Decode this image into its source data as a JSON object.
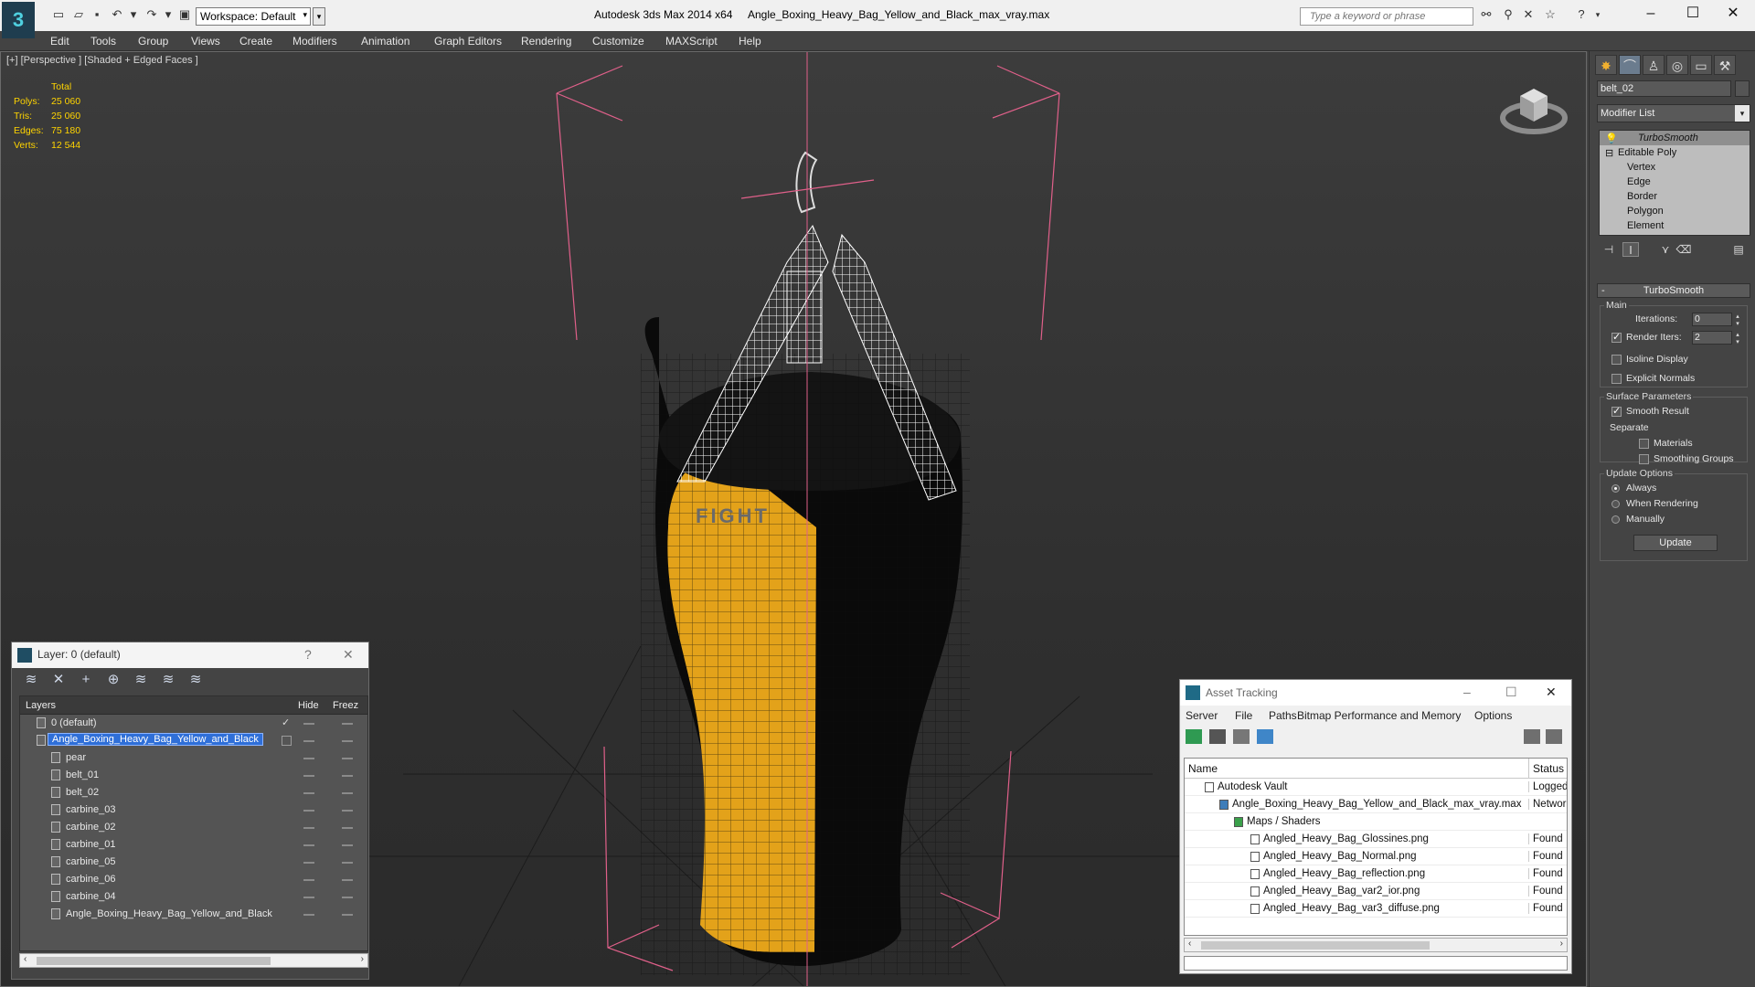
{
  "titlebar": {
    "workspace": "Workspace: Default",
    "app_title": "Autodesk 3ds Max  2014 x64",
    "file_title": "Angle_Boxing_Heavy_Bag_Yellow_and_Black_max_vray.max",
    "search_placeholder": "Type a keyword or phrase"
  },
  "menu": [
    "Edit",
    "Tools",
    "Group",
    "Views",
    "Create",
    "Modifiers",
    "Animation",
    "Graph Editors",
    "Rendering",
    "Customize",
    "MAXScript",
    "Help"
  ],
  "viewport": {
    "label": "[+] [Perspective ] [Shaded + Edged Faces ]",
    "stats": {
      "header": "Total",
      "rows": [
        {
          "label": "Polys:",
          "value": "25 060"
        },
        {
          "label": "Tris:",
          "value": "25 060"
        },
        {
          "label": "Edges:",
          "value": "75 180"
        },
        {
          "label": "Verts:",
          "value": "12 544"
        }
      ]
    },
    "bag_text": "FIGHT"
  },
  "layer_dialog": {
    "title": "Layer: 0 (default)",
    "help": "?",
    "columns": {
      "layers": "Layers",
      "hide": "Hide",
      "freeze": "Freez"
    },
    "rows": [
      {
        "name": "0 (default)"
      },
      {
        "name": "Angle_Boxing_Heavy_Bag_Yellow_and_Black"
      },
      {
        "name": "pear"
      },
      {
        "name": "belt_01"
      },
      {
        "name": "belt_02"
      },
      {
        "name": "carbine_03"
      },
      {
        "name": "carbine_02"
      },
      {
        "name": "carbine_01"
      },
      {
        "name": "carbine_05"
      },
      {
        "name": "carbine_06"
      },
      {
        "name": "carbine_04"
      },
      {
        "name": "Angle_Boxing_Heavy_Bag_Yellow_and_Black"
      }
    ]
  },
  "asset_dialog": {
    "title": "Asset Tracking",
    "menu": [
      "Server",
      "File",
      "Paths",
      "Bitmap Performance and Memory",
      "Options"
    ],
    "columns": {
      "name": "Name",
      "status": "Status"
    },
    "rows": [
      {
        "name": "Autodesk Vault",
        "status": "Logged"
      },
      {
        "name": "Angle_Boxing_Heavy_Bag_Yellow_and_Black_max_vray.max",
        "status": "Network"
      },
      {
        "name": "Maps / Shaders",
        "status": ""
      },
      {
        "name": "Angled_Heavy_Bag_Glossines.png",
        "status": "Found"
      },
      {
        "name": "Angled_Heavy_Bag_Normal.png",
        "status": "Found"
      },
      {
        "name": "Angled_Heavy_Bag_reflection.png",
        "status": "Found"
      },
      {
        "name": "Angled_Heavy_Bag_var2_ior.png",
        "status": "Found"
      },
      {
        "name": "Angled_Heavy_Bag_var3_diffuse.png",
        "status": "Found"
      }
    ]
  },
  "command_panel": {
    "object_name": "belt_02",
    "modifier_list": "Modifier List",
    "stack": [
      {
        "name": "TurboSmooth"
      },
      {
        "name": "Editable Poly"
      },
      {
        "name": "Vertex"
      },
      {
        "name": "Edge"
      },
      {
        "name": "Border"
      },
      {
        "name": "Polygon"
      },
      {
        "name": "Element"
      }
    ],
    "rollout": {
      "title": "TurboSmooth",
      "collapse": "-",
      "main_group": "Main",
      "iterations_label": "Iterations:",
      "iterations_value": "0",
      "render_iters_label": "Render Iters:",
      "render_iters_value": "2",
      "isoline": "Isoline Display",
      "explicit_normals": "Explicit Normals",
      "surface_group": "Surface Parameters",
      "smooth_result": "Smooth Result",
      "separate": "Separate",
      "materials": "Materials",
      "smoothing_groups": "Smoothing Groups",
      "update_group": "Update Options",
      "always": "Always",
      "when_rendering": "When Rendering",
      "manually": "Manually",
      "update_button": "Update"
    }
  },
  "colors": {
    "stats": "#ffd400",
    "selection": "#2f6fd8",
    "bag_yellow": "#e3a21a",
    "gizmo_pink": "#e0608a"
  }
}
